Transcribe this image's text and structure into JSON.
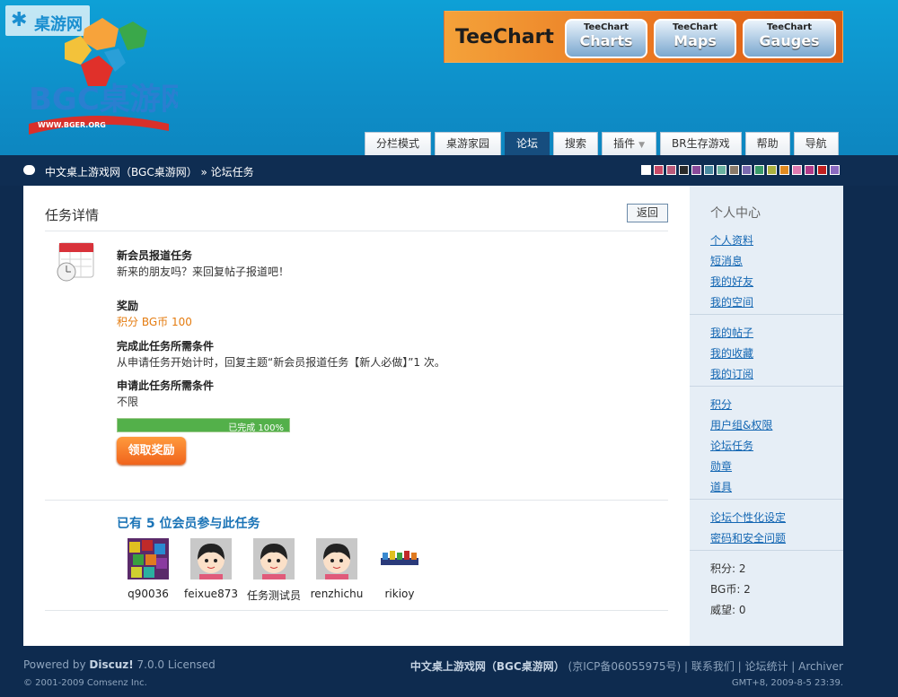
{
  "header": {
    "corner_badge": "桌游网",
    "logo_text": "BGC桌游网",
    "logo_url": "WWW.BGER.ORG",
    "banner": {
      "brand": "TeeChart",
      "pills": [
        {
          "small": "TeeChart",
          "large": "Charts"
        },
        {
          "small": "TeeChart",
          "large": "Maps"
        },
        {
          "small": "TeeChart",
          "large": "Gauges"
        }
      ]
    }
  },
  "nav": {
    "tabs": [
      "分栏模式",
      "桌游家园",
      "论坛",
      "搜索",
      "插件",
      "BR生存游戏",
      "帮助",
      "导航"
    ],
    "active": "论坛"
  },
  "breadcrumb": {
    "text": "中文桌上游戏网（BGC桌游网） » 论坛任务"
  },
  "swatches": [
    "#ffffff",
    "#c94a67",
    "#b95a7a",
    "#2a2a2a",
    "#8a4a9a",
    "#4a8aa0",
    "#6ab0a0",
    "#8a7a6a",
    "#7a6ab0",
    "#3a9a6a",
    "#aab040",
    "#e08a20",
    "#e07ab0",
    "#b03a8a",
    "#c02020",
    "#8a6ac0"
  ],
  "task": {
    "heading": "任务详情",
    "back_label": "返回",
    "name": "新会员报道任务",
    "desc": "新来的朋友吗？来回复帖子报道吧！",
    "reward_title": "奖励",
    "reward_value": "积分 BG币 100",
    "complete_title": "完成此任务所需条件",
    "complete_text": "从申请任务开始计时，回复主题“新会员报道任务【新人必做】”1 次。",
    "apply_title": "申请此任务所需条件",
    "apply_text": "不限",
    "progress_label": "已完成 100%",
    "progress_fraction": 1.0,
    "claim_label": "领取奖励"
  },
  "participants": {
    "title": "已有 5 位会员参与此任务",
    "members": [
      "q90036",
      "feixue873",
      "任务测试员",
      "renzhichu",
      "rikioy"
    ]
  },
  "sidebar": {
    "heading": "个人中心",
    "group1": [
      "个人资料",
      "短消息",
      "我的好友",
      "我的空间"
    ],
    "group2": [
      "我的帖子",
      "我的收藏",
      "我的订阅"
    ],
    "group3": [
      "积分",
      "用户组&权限",
      "论坛任务",
      "勋章",
      "道具"
    ],
    "group4": [
      "论坛个性化设定",
      "密码和安全问题"
    ],
    "stats": [
      "积分: 2",
      "BG币: 2",
      "威望: 0"
    ]
  },
  "footer": {
    "powered_prefix": "Powered by ",
    "powered_brand": "Discuz!",
    "powered_suffix": " 7.0.0 Licensed",
    "copyright": "© 2001-2009 Comsenz Inc.",
    "site_name": "中文桌上游戏网（BGC桌游网）",
    "links_text": "(京ICP备06055975号) | 联系我们 | 论坛统计 | Archiver",
    "gmt": "GMT+8, 2009-8-5 23:39."
  }
}
